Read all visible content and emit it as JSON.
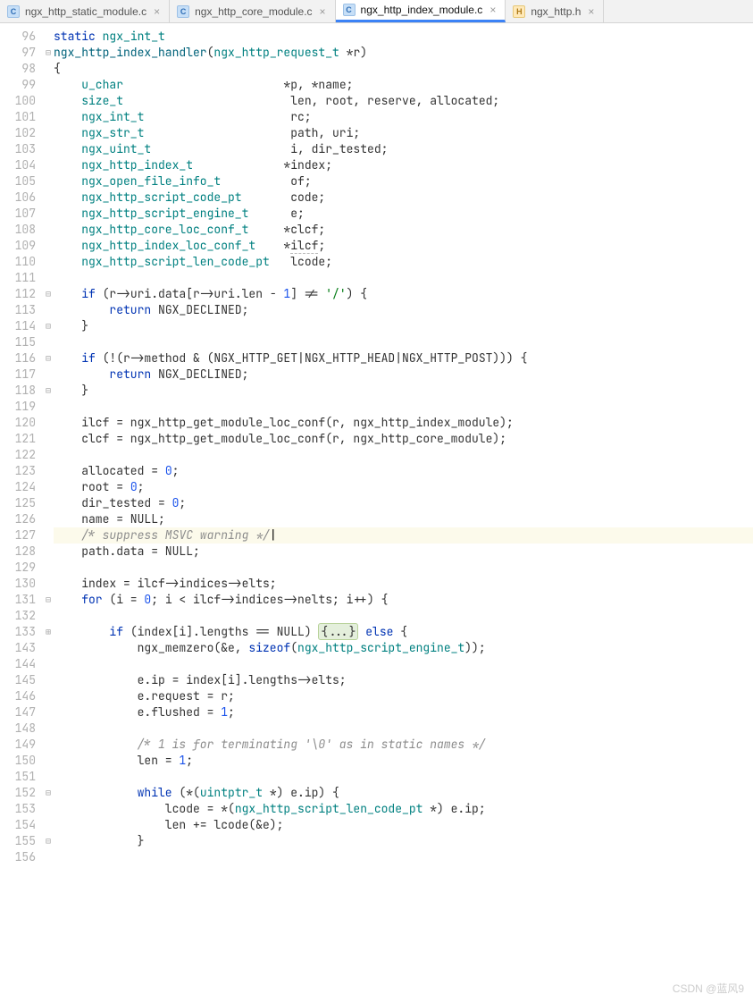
{
  "tabs": [
    {
      "icon": "c",
      "name": "ngx_http_static_module.c",
      "active": false
    },
    {
      "icon": "c",
      "name": "ngx_http_core_module.c",
      "active": false
    },
    {
      "icon": "c",
      "name": "ngx_http_index_module.c",
      "active": true
    },
    {
      "icon": "h",
      "name": "ngx_http.h",
      "active": false
    }
  ],
  "watermark": "CSDN @蓝风9",
  "lines": [
    {
      "n": 96,
      "f": "",
      "h": "<span class='kw'>static</span> <span class='ty'>ngx_int_t</span>"
    },
    {
      "n": 97,
      "f": "⊟",
      "h": "<span class='fn'>ngx_http_index_handler</span>(<span class='ty'>ngx_http_request_t</span> *<span>r</span>)"
    },
    {
      "n": 98,
      "f": "",
      "h": "{"
    },
    {
      "n": 99,
      "f": "",
      "h": "    <span class='ty'>u_char</span>                       *p, *name;"
    },
    {
      "n": 100,
      "f": "",
      "h": "    <span class='ty'>size_t</span>                        len, root, reserve, allocated;"
    },
    {
      "n": 101,
      "f": "",
      "h": "    <span class='ty'>ngx_int_t</span>                     rc;"
    },
    {
      "n": 102,
      "f": "",
      "h": "    <span class='ty'>ngx_str_t</span>                     path, uri;"
    },
    {
      "n": 103,
      "f": "",
      "h": "    <span class='ty'>ngx_uint_t</span>                    i, dir_tested;"
    },
    {
      "n": 104,
      "f": "",
      "h": "    <span class='ty'>ngx_http_index_t</span>             *index;"
    },
    {
      "n": 105,
      "f": "",
      "h": "    <span class='ty'>ngx_open_file_info_t</span>          of;"
    },
    {
      "n": 106,
      "f": "",
      "h": "    <span class='ty'>ngx_http_script_code_pt</span>       code;"
    },
    {
      "n": 107,
      "f": "",
      "h": "    <span class='ty'>ngx_http_script_engine_t</span>      e;"
    },
    {
      "n": 108,
      "f": "",
      "h": "    <span class='ty'>ngx_http_core_loc_conf_t</span>     *clcf;"
    },
    {
      "n": 109,
      "f": "",
      "h": "    <span class='ty'>ngx_http_index_loc_conf_t</span>    *<span class='ul'>ilcf</span>;"
    },
    {
      "n": 110,
      "f": "",
      "h": "    <span class='ty'>ngx_http_script_len_code_pt</span>   lcode;"
    },
    {
      "n": 111,
      "f": "",
      "h": ""
    },
    {
      "n": 112,
      "f": "⊟",
      "h": "    <span class='kw'>if</span> (r-&gt;uri.data[r-&gt;uri.len - <span class='num'>1</span>] != <span class='str'>'/'</span>) {"
    },
    {
      "n": 113,
      "f": "",
      "h": "        <span class='kw'>return</span> NGX_DECLINED;"
    },
    {
      "n": 114,
      "f": "⊟",
      "h": "    }"
    },
    {
      "n": 115,
      "f": "",
      "h": ""
    },
    {
      "n": 116,
      "f": "⊟",
      "h": "    <span class='kw'>if</span> (!(r-&gt;method &amp; (NGX_HTTP_GET|NGX_HTTP_HEAD|NGX_HTTP_POST))) {"
    },
    {
      "n": 117,
      "f": "",
      "h": "        <span class='kw'>return</span> NGX_DECLINED;"
    },
    {
      "n": 118,
      "f": "⊟",
      "h": "    }"
    },
    {
      "n": 119,
      "f": "",
      "h": ""
    },
    {
      "n": 120,
      "f": "",
      "h": "    ilcf = ngx_http_get_module_loc_conf(r, ngx_http_index_module);"
    },
    {
      "n": 121,
      "f": "",
      "h": "    clcf = ngx_http_get_module_loc_conf(r, ngx_http_core_module);"
    },
    {
      "n": 122,
      "f": "",
      "h": ""
    },
    {
      "n": 123,
      "f": "",
      "h": "    allocated = <span class='num'>0</span>;"
    },
    {
      "n": 124,
      "f": "",
      "h": "    root = <span class='num'>0</span>;"
    },
    {
      "n": 125,
      "f": "",
      "h": "    dir_tested = <span class='num'>0</span>;"
    },
    {
      "n": 126,
      "f": "",
      "h": "    name = NULL;"
    },
    {
      "n": 127,
      "f": "",
      "h": "    <span class='cmt'>/* suppress MSVC warning */</span><span class='caret'></span>",
      "hl": true
    },
    {
      "n": 128,
      "f": "",
      "h": "    path.data = NULL;"
    },
    {
      "n": 129,
      "f": "",
      "h": ""
    },
    {
      "n": 130,
      "f": "",
      "h": "    index = ilcf-&gt;indices-&gt;elts;"
    },
    {
      "n": 131,
      "f": "⊟",
      "h": "    <span class='kw'>for</span> (i = <span class='num'>0</span>; i &lt; ilcf-&gt;indices-&gt;nelts; i++) {"
    },
    {
      "n": 132,
      "f": "",
      "h": ""
    },
    {
      "n": 133,
      "f": "⊞",
      "h": "        <span class='kw'>if</span> (index[i].lengths == NULL) <span class='fd'>{...}</span> <span class='kw'>else</span> {"
    },
    {
      "n": 143,
      "f": "",
      "h": "            ngx_memzero(&amp;e, <span class='kw'>sizeof</span>(<span class='ty'>ngx_http_script_engine_t</span>));"
    },
    {
      "n": 144,
      "f": "",
      "h": ""
    },
    {
      "n": 145,
      "f": "",
      "h": "            e.ip = index[i].lengths-&gt;elts;"
    },
    {
      "n": 146,
      "f": "",
      "h": "            e.request = r;"
    },
    {
      "n": 147,
      "f": "",
      "h": "            e.flushed = <span class='num'>1</span>;"
    },
    {
      "n": 148,
      "f": "",
      "h": ""
    },
    {
      "n": 149,
      "f": "",
      "h": "            <span class='cmt'>/* 1 is for terminating '\\0' as in static names */</span>"
    },
    {
      "n": 150,
      "f": "",
      "h": "            len = <span class='num'>1</span>;"
    },
    {
      "n": 151,
      "f": "",
      "h": ""
    },
    {
      "n": 152,
      "f": "⊟",
      "h": "            <span class='kw'>while</span> (*(<span class='ty'>uintptr_t</span> *) e.ip) {"
    },
    {
      "n": 153,
      "f": "",
      "h": "                lcode = *(<span class='ty'>ngx_http_script_len_code_pt</span> *) e.ip;"
    },
    {
      "n": 154,
      "f": "",
      "h": "                len += lcode(&amp;e);"
    },
    {
      "n": 155,
      "f": "⊟",
      "h": "            }"
    },
    {
      "n": 156,
      "f": "",
      "h": ""
    }
  ]
}
